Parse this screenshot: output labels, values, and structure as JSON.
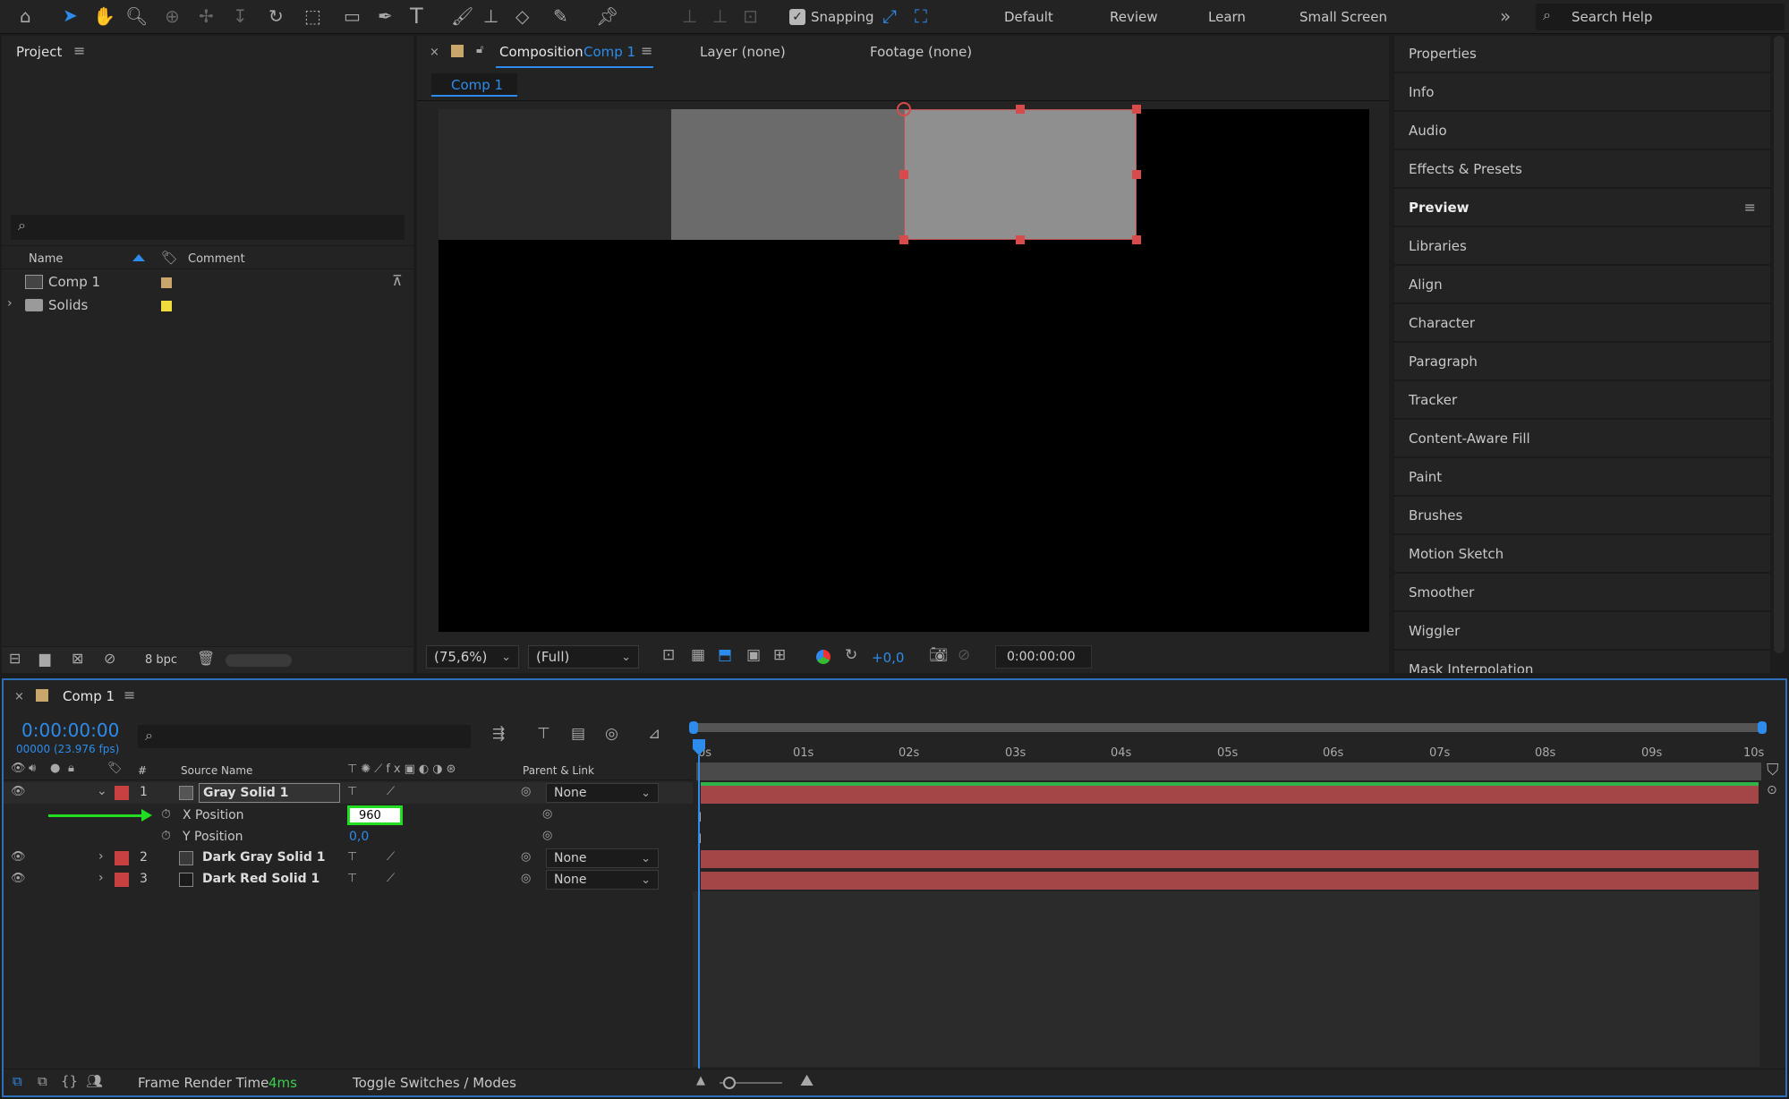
{
  "toolbar": {
    "snapping_label": "Snapping",
    "workspaces": [
      "Default",
      "Review",
      "Learn",
      "Small Screen"
    ],
    "search_placeholder": "Search Help"
  },
  "project": {
    "title": "Project",
    "columns": {
      "name": "Name",
      "comment": "Comment"
    },
    "items": [
      {
        "name": "Comp 1",
        "label_color": "#c9a66b"
      },
      {
        "name": "Solids",
        "label_color": "#f0dc3c"
      }
    ],
    "bpc": "8 bpc"
  },
  "viewer": {
    "tabs": {
      "composition_prefix": "Composition",
      "composition_name": "Comp 1",
      "layer": "Layer (none)",
      "footage": "Footage (none)"
    },
    "subtab": "Comp 1",
    "zoom": "(75,6%)",
    "resolution": "(Full)",
    "exposure": "+0,0",
    "timecode": "0:00:00:00"
  },
  "right_panels": [
    "Properties",
    "Info",
    "Audio",
    "Effects & Presets",
    "Preview",
    "Libraries",
    "Align",
    "Character",
    "Paragraph",
    "Tracker",
    "Content-Aware Fill",
    "Paint",
    "Brushes",
    "Motion Sketch",
    "Smoother",
    "Wiggler",
    "Mask Interpolation"
  ],
  "timeline": {
    "title": "Comp 1",
    "timecode": "0:00:00:00",
    "frames": "00000 (23.976 fps)",
    "columns": {
      "num": "#",
      "source": "Source Name",
      "parent": "Parent & Link"
    },
    "ruler": [
      "0s",
      "01s",
      "02s",
      "03s",
      "04s",
      "05s",
      "06s",
      "07s",
      "08s",
      "09s",
      "10s"
    ],
    "layers": [
      {
        "num": "1",
        "name": "Gray Solid 1",
        "label_color": "#c84040",
        "parent": "None"
      },
      {
        "num": "2",
        "name": "Dark Gray Solid 1",
        "label_color": "#c84040",
        "parent": "None"
      },
      {
        "num": "3",
        "name": "Dark Red Solid 1",
        "label_color": "#c84040",
        "parent": "None"
      }
    ],
    "properties": [
      {
        "name": "X Position",
        "value": "960"
      },
      {
        "name": "Y Position",
        "value": "0,0"
      }
    ],
    "footer": {
      "render_label": "Frame Render Time",
      "render_value": "4ms",
      "toggle": "Toggle Switches / Modes"
    }
  },
  "colors": {
    "accent": "#2d8ceb",
    "layer_bar": "#a44647",
    "highlight": "#22dd22",
    "handle": "#d94a4a"
  }
}
